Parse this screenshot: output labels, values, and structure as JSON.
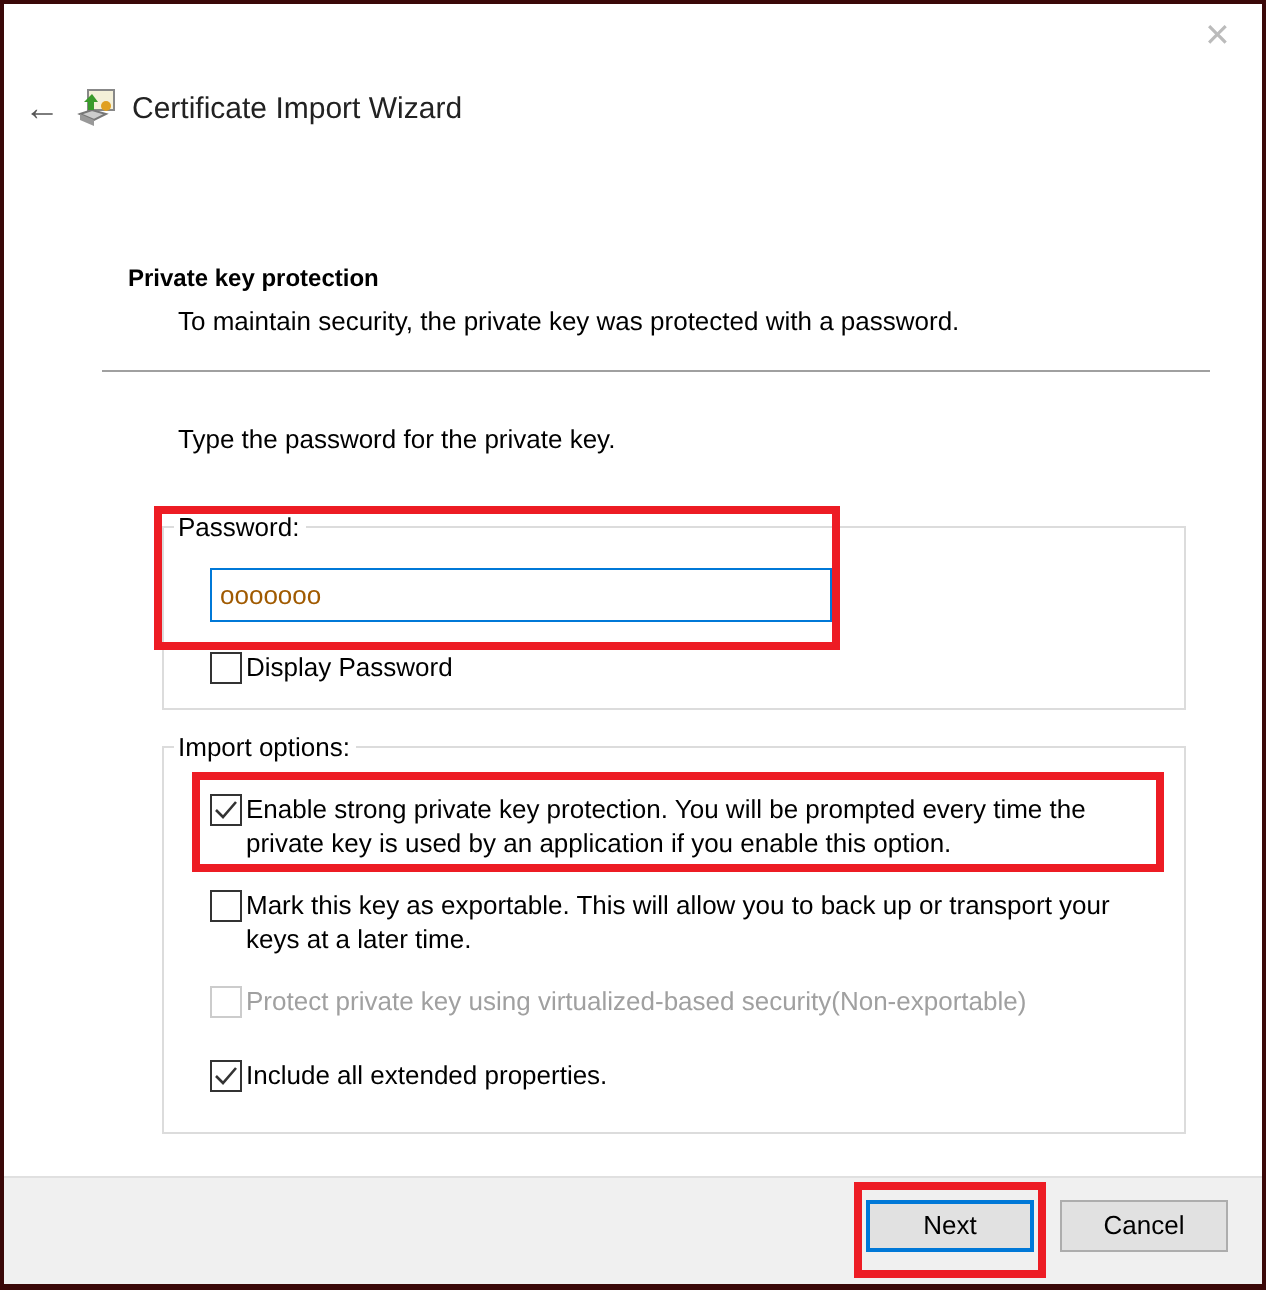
{
  "window": {
    "close": "✕",
    "back": "←",
    "title": "Certificate Import Wizard"
  },
  "page": {
    "heading": "Private key protection",
    "subtitle": "To maintain security, the private key was protected with a password.",
    "instruction": "Type the password for the private key."
  },
  "password_group": {
    "legend": "Password:",
    "value": "ooooooo",
    "highlighted": true,
    "show_password": {
      "label": "Display Password",
      "checked": false
    }
  },
  "import_options": {
    "legend": "Import options:",
    "options": [
      {
        "label": "Enable strong private key protection. You will be prompted every time the private key is used by an application if you enable this option.",
        "checked": true,
        "disabled": false,
        "highlighted": true
      },
      {
        "label": "Mark this key as exportable. This will allow you to back up or transport your keys at a later time.",
        "checked": false,
        "disabled": false,
        "highlighted": false
      },
      {
        "label": "Protect private key using virtualized-based security(Non-exportable)",
        "checked": false,
        "disabled": true,
        "highlighted": false
      },
      {
        "label": "Include all extended properties.",
        "checked": true,
        "disabled": false,
        "highlighted": false
      }
    ]
  },
  "buttons": [
    {
      "label": "Next",
      "default": true,
      "highlighted": true
    },
    {
      "label": "Cancel",
      "default": false,
      "highlighted": false
    }
  ]
}
